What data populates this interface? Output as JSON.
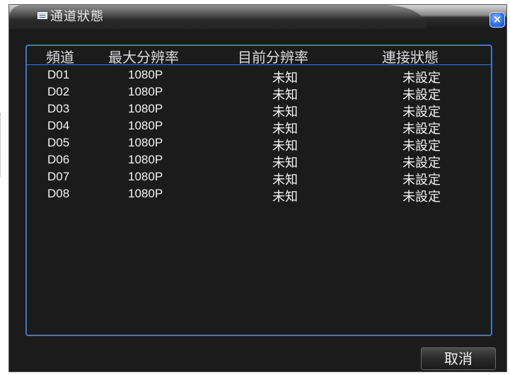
{
  "window": {
    "title": "通道狀態",
    "close_label": "×"
  },
  "table": {
    "headers": [
      "頻道",
      "最大分辨率",
      "目前分辨率",
      "連接狀態"
    ],
    "rows": [
      {
        "channel": "D01",
        "max_res": "1080P",
        "cur_res": "未知",
        "status": "未設定"
      },
      {
        "channel": "D02",
        "max_res": "1080P",
        "cur_res": "未知",
        "status": "未設定"
      },
      {
        "channel": "D03",
        "max_res": "1080P",
        "cur_res": "未知",
        "status": "未設定"
      },
      {
        "channel": "D04",
        "max_res": "1080P",
        "cur_res": "未知",
        "status": "未設定"
      },
      {
        "channel": "D05",
        "max_res": "1080P",
        "cur_res": "未知",
        "status": "未設定"
      },
      {
        "channel": "D06",
        "max_res": "1080P",
        "cur_res": "未知",
        "status": "未設定"
      },
      {
        "channel": "D07",
        "max_res": "1080P",
        "cur_res": "未知",
        "status": "未設定"
      },
      {
        "channel": "D08",
        "max_res": "1080P",
        "cur_res": "未知",
        "status": "未設定"
      }
    ]
  },
  "footer": {
    "cancel_label": "取消"
  },
  "colors": {
    "background": "#1b1b1b",
    "accent_border": "#3a78c8",
    "close_button": "#2d6fe0"
  }
}
